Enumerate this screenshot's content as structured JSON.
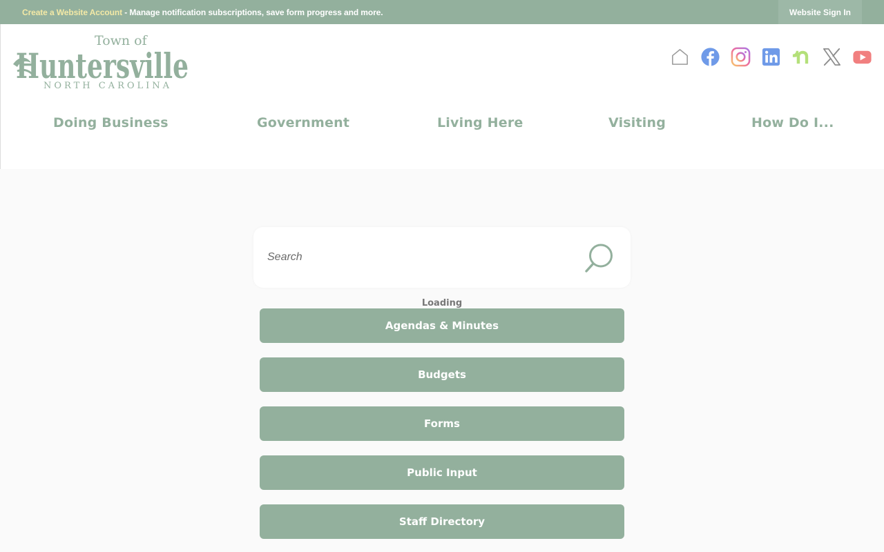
{
  "topbar": {
    "account_link": "Create a Website Account",
    "account_text": " - Manage notification subscriptions, save form progress and more.",
    "signin": "Website Sign In"
  },
  "logo": {
    "town_of": "Town of",
    "name": "Huntersville",
    "state": "NORTH CAROLINA"
  },
  "social": [
    "home-icon",
    "facebook-icon",
    "instagram-icon",
    "linkedin-icon",
    "nextdoor-icon",
    "x-icon",
    "youtube-icon"
  ],
  "nav": {
    "items": [
      "Doing Business",
      "Government",
      "Living Here",
      "Visiting",
      "How Do I..."
    ]
  },
  "search": {
    "placeholder": "Search"
  },
  "status": {
    "loading": "Loading"
  },
  "quick_links": [
    "Agendas & Minutes",
    "Budgets",
    "Forms",
    "Public Input",
    "Staff Directory"
  ],
  "colors": {
    "brand_green": "#93b09d",
    "topbar_link": "#f3e9a6",
    "page_bg": "#fafafa"
  }
}
